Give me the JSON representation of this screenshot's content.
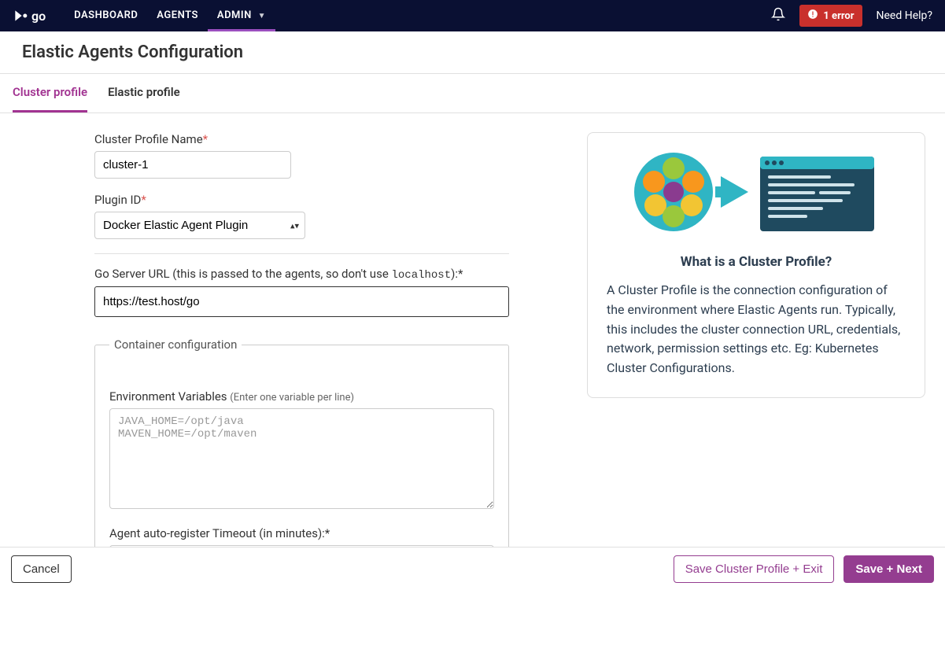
{
  "nav": {
    "logo_text": "go",
    "items": [
      {
        "label": "DASHBOARD",
        "active": false
      },
      {
        "label": "AGENTS",
        "active": false
      },
      {
        "label": "ADMIN",
        "active": true,
        "has_caret": true
      }
    ],
    "error_count_label": "1 error",
    "need_help": "Need Help?"
  },
  "page": {
    "title": "Elastic Agents Configuration"
  },
  "tabs": {
    "cluster_profile": "Cluster profile",
    "elastic_profile": "Elastic profile"
  },
  "form": {
    "cluster_profile_name_label": "Cluster Profile Name",
    "cluster_profile_name_value": "cluster-1",
    "plugin_id_label": "Plugin ID",
    "plugin_id_value": "Docker Elastic Agent Plugin",
    "go_server_url_label_pre": "Go Server URL (this is passed to the agents, so don't use ",
    "go_server_url_label_mono": "localhost",
    "go_server_url_label_post": "):*",
    "go_server_url_value": "https://test.host/go",
    "container_config_legend": "Container configuration",
    "env_vars_label": "Environment Variables",
    "env_vars_hint": "(Enter one variable per line)",
    "env_vars_placeholder": "JAVA_HOME=/opt/java\nMAVEN_HOME=/opt/maven",
    "agent_timeout_label": "Agent auto-register Timeout (in minutes):*"
  },
  "info": {
    "title": "What is a Cluster Profile?",
    "body": "A Cluster Profile is the connection configuration of the environment where Elastic Agents run. Typically, this includes the cluster connection URL, credentials, network, permission settings etc. Eg: Kubernetes Cluster Configurations."
  },
  "footer": {
    "cancel": "Cancel",
    "save_exit": "Save Cluster Profile + Exit",
    "save_next": "Save + Next"
  }
}
